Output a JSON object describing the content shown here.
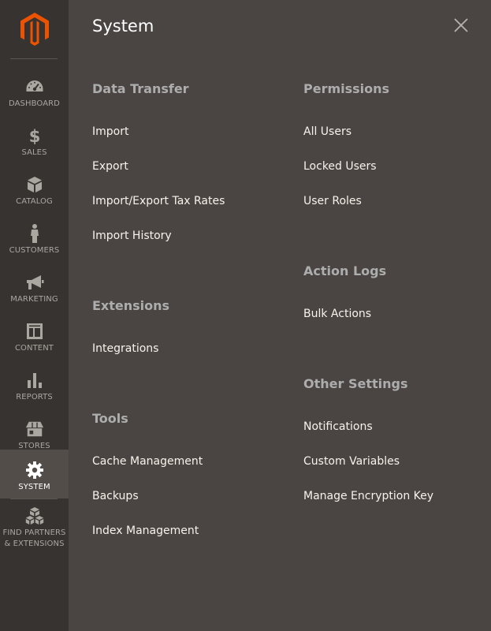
{
  "brand": {
    "logo_icon": "magento-logo-icon",
    "accent_color": "#eb5202"
  },
  "sidebar": {
    "items": [
      {
        "label": "Dashboard",
        "icon": "dashboard-gauge-icon"
      },
      {
        "label": "Sales",
        "icon": "dollar-icon"
      },
      {
        "label": "Catalog",
        "icon": "cube-icon"
      },
      {
        "label": "Customers",
        "icon": "person-icon"
      },
      {
        "label": "Marketing",
        "icon": "megaphone-icon"
      },
      {
        "label": "Content",
        "icon": "layout-icon"
      },
      {
        "label": "Reports",
        "icon": "bar-chart-icon"
      },
      {
        "label": "Stores",
        "icon": "storefront-icon"
      },
      {
        "label": "System",
        "icon": "gear-icon",
        "active": true
      },
      {
        "label": "Find Partners & Extensions",
        "icon": "boxes-icon"
      }
    ]
  },
  "panel": {
    "title": "System",
    "close_icon": "close-icon",
    "sections": {
      "data_transfer": {
        "title": "Data Transfer",
        "links": [
          "Import",
          "Export",
          "Import/Export Tax Rates",
          "Import History"
        ]
      },
      "extensions": {
        "title": "Extensions",
        "links": [
          "Integrations"
        ]
      },
      "tools": {
        "title": "Tools",
        "links": [
          "Cache Management",
          "Backups",
          "Index Management"
        ]
      },
      "permissions": {
        "title": "Permissions",
        "links": [
          "All Users",
          "Locked Users",
          "User Roles"
        ]
      },
      "action_logs": {
        "title": "Action Logs",
        "links": [
          "Bulk Actions"
        ]
      },
      "other_settings": {
        "title": "Other Settings",
        "links": [
          "Notifications",
          "Custom Variables",
          "Manage Encryption Key"
        ]
      }
    }
  }
}
